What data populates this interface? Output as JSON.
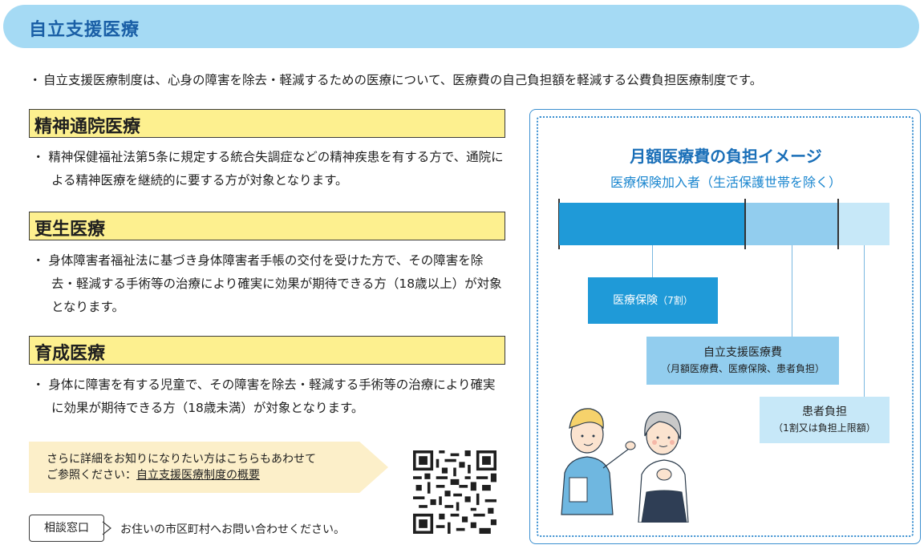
{
  "header": {
    "title": "自立支援医療"
  },
  "intro": {
    "bullet": "・",
    "text": "自立支援医療制度は、心身の障害を除去・軽減するための医療について、医療費の自己負担額を軽減する公費負担医療制度です。"
  },
  "sections": [
    {
      "title": "精神通院医療",
      "text": "・ 精神保健福祉法第5条に規定する統合失調症などの精神疾患を有する方で、通院による精神医療を継続的に要する方が対象となります。"
    },
    {
      "title": "更生医療",
      "text": "・ 身体障害者福祉法に基づき身体障害者手帳の交付を受けた方で、その障害を除去・軽減する手術等の治療により確実に効果が期待できる方（18歳以上）が対象となります。"
    },
    {
      "title": "育成医療",
      "text": "・ 身体に障害を有する児童で、その障害を除去・軽減する手術等の治療により確実に効果が期待できる方（18歳未満）が対象となります。"
    }
  ],
  "info": {
    "line1": "さらに詳細をお知りになりたい方はこちらもあわせて",
    "line2_prefix": "ご参照ください：",
    "link": "自立支援医療制度の概要"
  },
  "consult": {
    "label": "相談窓口",
    "text": "お住いの市区町村へお問い合わせください。"
  },
  "panel": {
    "title": "月額医療費の負担イメージ",
    "subtitle": "医療保険加入者（生活保護世帯を除く）",
    "boxes": [
      {
        "label": "医療保険",
        "note": "（7割）"
      },
      {
        "label": "自立支援医療費",
        "note": "（月額医療費、医療保険、患者負担）"
      },
      {
        "label": "患者負担",
        "note": "（1割又は負担上限額）"
      }
    ],
    "shares": [
      7,
      2,
      1
    ]
  },
  "colors": {
    "accent": "#1a5fa6",
    "header_bg": "#a5daf4",
    "section_bg": "#fdf08f",
    "bar_dark": "#1f9ad8",
    "bar_mid": "#92cdee",
    "bar_light": "#c7e8f8"
  }
}
